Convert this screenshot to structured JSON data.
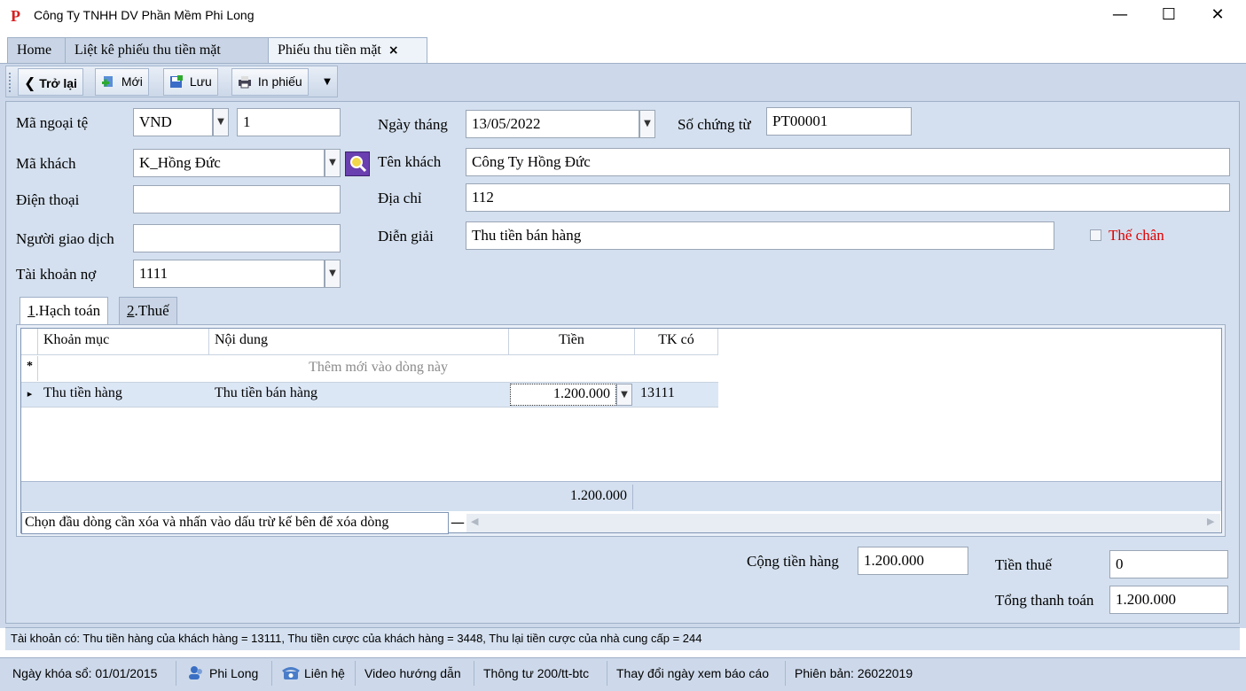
{
  "window": {
    "title": "Công Ty TNHH DV Phần Mềm Phi Long",
    "logo_text": "P",
    "minimize": "—",
    "maximize": "☐",
    "close": "✕"
  },
  "tabs": [
    {
      "label": "Home"
    },
    {
      "label": "Liệt kê phiếu thu tiền mặt"
    },
    {
      "label": "Phiếu thu tiền mặt",
      "close": "×"
    }
  ],
  "toolbar": {
    "back_label": "Trở lại",
    "new_label": "Mới",
    "save_label": "Lưu",
    "print_label": "In phiếu"
  },
  "form": {
    "currency_label": "Mã ngoại tệ",
    "currency_value": "VND",
    "rate_value": "1",
    "date_label": "Ngày tháng",
    "date_value": "13/05/2022",
    "voucher_label": "Số chứng từ",
    "voucher_value": "PT00001",
    "customer_code_label": "Mã khách",
    "customer_code_value": "K_Hồng Đức",
    "customer_name_label": "Tên khách",
    "customer_name_value": "Công Ty Hồng Đức",
    "phone_label": "Điện thoại",
    "phone_value": "",
    "address_label": "Địa chỉ",
    "address_value": "112",
    "contact_label": "Người giao dịch",
    "contact_value": "",
    "description_label": "Diễn giải",
    "description_value": "Thu tiền bán hàng",
    "deposit_label": "Thế chân",
    "debit_account_label": "Tài khoản nợ",
    "debit_account_value": "1111"
  },
  "inner_tabs": [
    {
      "num": "1",
      "label": ".Hạch toán"
    },
    {
      "num": "2",
      "label": ".Thuế"
    }
  ],
  "grid": {
    "columns": [
      "Khoản mục",
      "Nội dung",
      "Tiền",
      "TK có"
    ],
    "new_row_marker": "*",
    "new_row_hint": "Thêm mới vào dòng này",
    "row_marker": "▸",
    "rows": [
      {
        "item": "Thu tiền hàng",
        "content": "Thu tiền bán hàng",
        "amount": "1.200.000",
        "account": "13111"
      }
    ],
    "footer_total": "1.200.000",
    "delete_hint": "Chọn đầu dòng cần xóa và nhấn vào dấu trừ kế bên để xóa dòng",
    "minus": "—"
  },
  "totals": {
    "goods_label": "Cộng tiền hàng",
    "goods_value": "1.200.000",
    "tax_label": "Tiền thuế",
    "tax_value": "0",
    "grand_label": "Tổng thanh toán",
    "grand_value": "1.200.000"
  },
  "info_line": "Tài khoản có: Thu tiền hàng của khách hàng = 13111, Thu tiền cược của khách hàng = 3448, Thu lại tiền cược của nhà cung cấp = 244",
  "statusbar": {
    "lock_date": "Ngày khóa sổ: 01/01/2015",
    "user": "Phi Long",
    "contact": "Liên hệ",
    "video": "Video hướng dẫn",
    "circular": "Thông tư 200/tt-btc",
    "change_date": "Thay đổi ngày xem báo cáo",
    "version": "Phiên bản: 26022019"
  },
  "colors": {
    "panel": "#d4e0ef",
    "tab_active": "#eef3fa",
    "selected_row": "#dce7f6",
    "deposit_label": "#e00000"
  }
}
